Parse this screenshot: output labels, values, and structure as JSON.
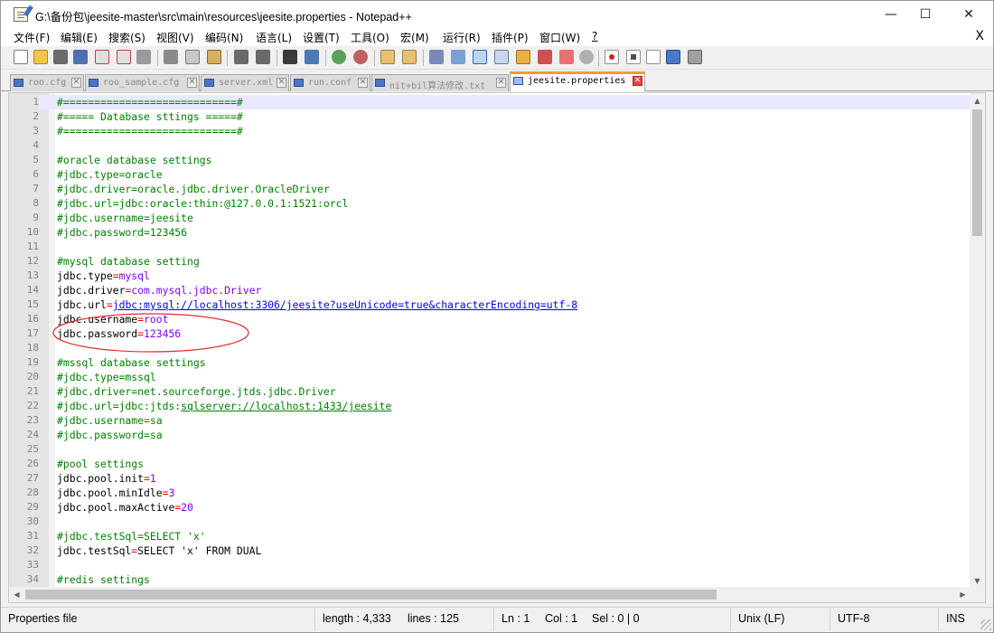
{
  "window": {
    "title": "G:\\备份包\\jeesite-master\\src\\main\\resources\\jeesite.properties - Notepad++",
    "minimize": "—",
    "maximize": "☐",
    "close": "✕"
  },
  "menu": {
    "items": [
      "文件(F)",
      "编辑(E)",
      "搜索(S)",
      "视图(V)",
      "编码(N)",
      "语言(L)",
      "设置(T)",
      "工具(O)",
      "宏(M)",
      "运行(R)",
      "插件(P)",
      "窗口(W)",
      "?"
    ],
    "close_doc": "X"
  },
  "toolbar": {
    "icons": [
      "new-file-icon",
      "open-file-icon",
      "save-icon",
      "save-all-icon",
      "close-icon",
      "close-all-icon",
      "print-icon",
      "cut-icon",
      "copy-icon",
      "paste-icon",
      "undo-icon",
      "redo-icon",
      "find-icon",
      "replace-icon",
      "zoom-in-icon",
      "zoom-out-icon",
      "sync-vertical-icon",
      "sync-horizontal-icon",
      "word-wrap-icon",
      "show-all-chars-icon",
      "indent-guide-icon",
      "doc-map-icon",
      "function-list-icon",
      "folder-workspace-icon",
      "monitor-icon",
      "record-macro-icon",
      "stop-record-icon",
      "play-macro-icon",
      "run-macro-multiple-icon",
      "save-macro-icon"
    ]
  },
  "tabs": [
    {
      "label": "roo.cfg",
      "active": false
    },
    {
      "label": "roo_sample.cfg",
      "active": false
    },
    {
      "label": "server.xml",
      "active": false
    },
    {
      "label": "run.conf",
      "active": false
    },
    {
      "label": "nit+bil算法修改.txt",
      "active": false
    },
    {
      "label": "jeesite.properties",
      "active": true
    }
  ],
  "editor": {
    "current_line": 1,
    "lines": [
      [
        [
          "c-com",
          "#============================#"
        ]
      ],
      [
        [
          "c-com",
          "#===== Database sttings =====#"
        ]
      ],
      [
        [
          "c-com",
          "#============================#"
        ]
      ],
      [],
      [
        [
          "c-com",
          "#oracle database settings"
        ]
      ],
      [
        [
          "c-com",
          "#jdbc.type=oracle"
        ]
      ],
      [
        [
          "c-com",
          "#jdbc.driver=oracle.jdbc.driver.OracleDriver"
        ]
      ],
      [
        [
          "c-com",
          "#jdbc.url=jdbc:oracle:thin:@127.0.0.1:1521:orcl"
        ]
      ],
      [
        [
          "c-com",
          "#jdbc.username=jeesite"
        ]
      ],
      [
        [
          "c-com",
          "#jdbc.password=123456"
        ]
      ],
      [],
      [
        [
          "c-com",
          "#mysql database setting"
        ]
      ],
      [
        [
          "c-key",
          "jdbc.type"
        ],
        [
          "c-op",
          "="
        ],
        [
          "c-val",
          "mysql"
        ]
      ],
      [
        [
          "c-key",
          "jdbc.driver"
        ],
        [
          "c-op",
          "="
        ],
        [
          "c-val",
          "com.mysql.jdbc.Driver"
        ]
      ],
      [
        [
          "c-key",
          "jdbc.url"
        ],
        [
          "c-op",
          "="
        ],
        [
          "c-link",
          "jdbc:mysql://localhost:3306/jeesite?useUnicode=true&characterEncoding=utf-8"
        ]
      ],
      [
        [
          "c-key",
          "jdbc.username"
        ],
        [
          "c-op",
          "="
        ],
        [
          "c-val",
          "root"
        ]
      ],
      [
        [
          "c-key",
          "jdbc.password"
        ],
        [
          "c-op",
          "="
        ],
        [
          "c-val",
          "123456"
        ]
      ],
      [],
      [
        [
          "c-com",
          "#mssql database settings"
        ]
      ],
      [
        [
          "c-com",
          "#jdbc.type=mssql"
        ]
      ],
      [
        [
          "c-com",
          "#jdbc.driver=net.sourceforge.jtds.jdbc.Driver"
        ]
      ],
      [
        [
          "c-com",
          "#jdbc.url=jdbc:jtds:"
        ],
        [
          "c-url",
          "sqlserver://localhost:1433/jeesite"
        ]
      ],
      [
        [
          "c-com",
          "#jdbc.username=sa"
        ]
      ],
      [
        [
          "c-com",
          "#jdbc.password=sa"
        ]
      ],
      [],
      [
        [
          "c-com",
          "#pool settings"
        ]
      ],
      [
        [
          "c-key",
          "jdbc.pool.init"
        ],
        [
          "c-op",
          "="
        ],
        [
          "c-val",
          "1"
        ]
      ],
      [
        [
          "c-key",
          "jdbc.pool.minIdle"
        ],
        [
          "c-op",
          "="
        ],
        [
          "c-val",
          "3"
        ]
      ],
      [
        [
          "c-key",
          "jdbc.pool.maxActive"
        ],
        [
          "c-op",
          "="
        ],
        [
          "c-val",
          "20"
        ]
      ],
      [],
      [
        [
          "c-com",
          "#jdbc.testSql=SELECT 'x'"
        ]
      ],
      [
        [
          "c-key",
          "jdbc.testSql"
        ],
        [
          "c-op",
          "="
        ],
        [
          "c-key",
          "SELECT 'x' FROM DUAL"
        ]
      ],
      [],
      [
        [
          "c-com",
          "#redis settings"
        ]
      ]
    ]
  },
  "status": {
    "file_type": "Properties file",
    "length": "length : 4,333",
    "lines": "lines : 125",
    "ln": "Ln : 1",
    "col": "Col : 1",
    "sel": "Sel : 0 | 0",
    "eol": "Unix (LF)",
    "encoding": "UTF-8",
    "mode": "INS"
  },
  "colors": {
    "comment": "#008000",
    "operator": "#ff0000",
    "value": "#8000ff",
    "link": "#0000ff",
    "active_tab_accent": "#fa9a28",
    "annotation": "#e03030"
  }
}
